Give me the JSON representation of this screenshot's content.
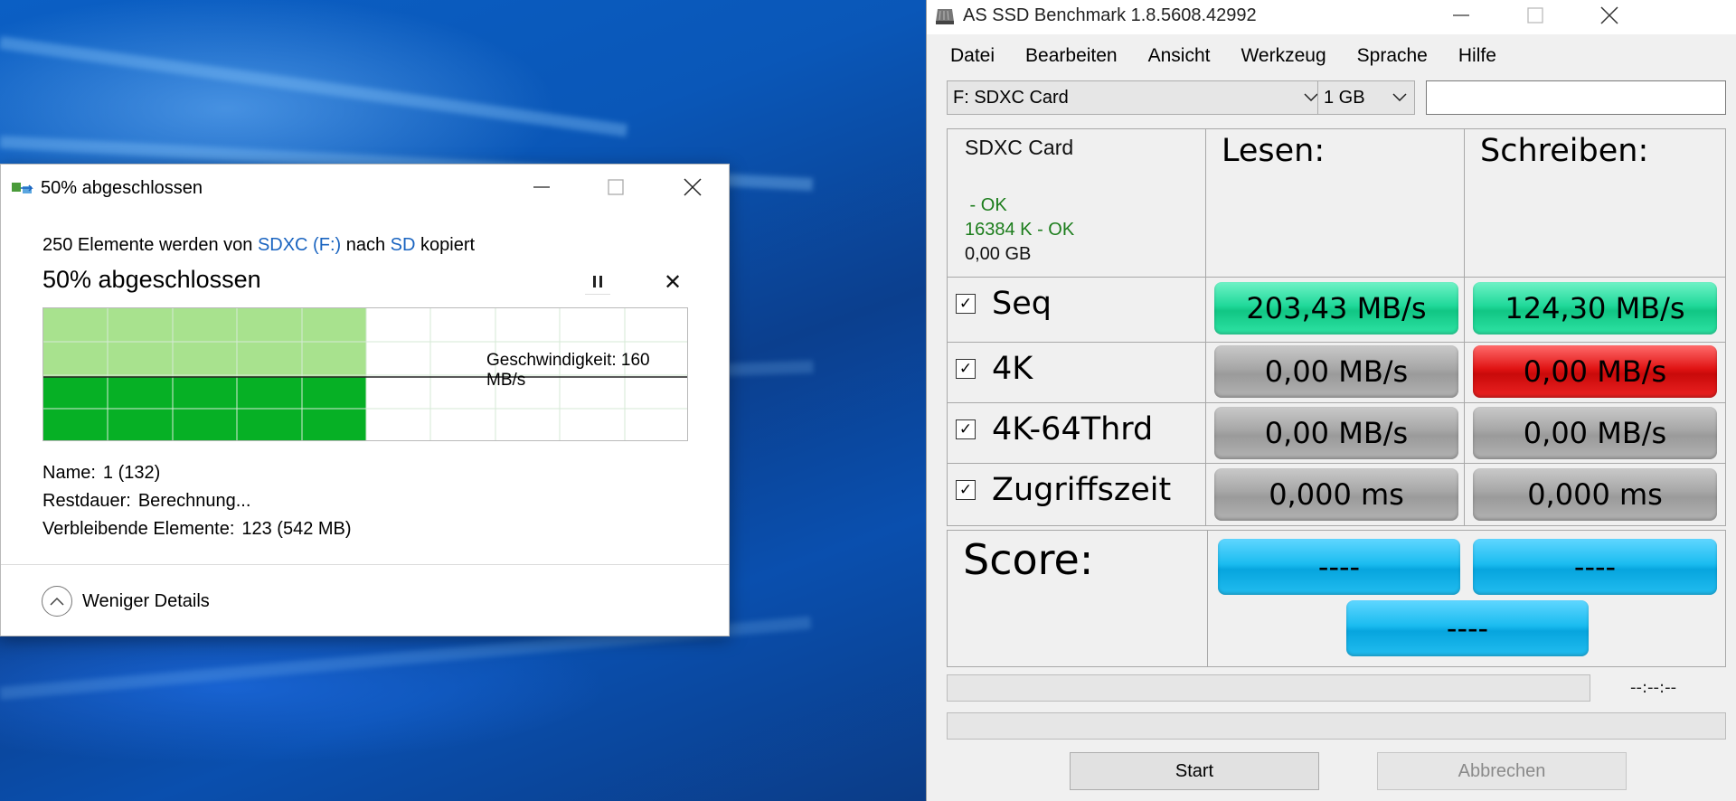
{
  "copy_dialog": {
    "title": "50% abgeschlossen",
    "from_prefix": "250 Elemente werden von",
    "source": "SDXC (F:)",
    "middle": "nach",
    "destination": "SD",
    "suffix": "kopiert",
    "heading": "50% abgeschlossen",
    "progress_fraction": 0.5,
    "speed_label": "Geschwindigkeit: 160 MB/s",
    "name_label": "Name:",
    "name_value": "1 (132)",
    "remaining_time_label": "Restdauer:",
    "remaining_time_value": "Berechnung...",
    "remaining_items_label": "Verbleibende Elemente:",
    "remaining_items_value": "123 (542 MB)",
    "less_details": "Weniger Details",
    "colors": {
      "fill_light": "#a8e28e",
      "fill_dark": "#06b025",
      "link": "#1a64c0"
    }
  },
  "as_ssd": {
    "title": "AS SSD Benchmark 1.8.5608.42992",
    "menu": [
      "Datei",
      "Bearbeiten",
      "Ansicht",
      "Werkzeug",
      "Sprache",
      "Hilfe"
    ],
    "drive_select": "F: SDXC Card",
    "size_select": "1 GB",
    "drive_info": {
      "name": "SDXC Card",
      "line1": " - OK",
      "line2": "16384 K - OK",
      "line3": "0,00 GB"
    },
    "col_read": "Lesen:",
    "col_write": "Schreiben:",
    "rows": [
      {
        "label": "Seq",
        "checked": "☑",
        "read": "203,43 MB/s",
        "write": "124,30 MB/s"
      },
      {
        "label": "4K",
        "checked": "☑",
        "read": "0,00 MB/s",
        "write": "0,00 MB/s"
      },
      {
        "label": "4K-64Thrd",
        "checked": "☑",
        "read": "0,00 MB/s",
        "write": "0,00 MB/s"
      },
      {
        "label": "Zugriffszeit",
        "checked": "☑",
        "read": "0,000 ms",
        "write": "0,000 ms"
      }
    ],
    "score_label": "Score:",
    "score_read": "----",
    "score_write": "----",
    "score_total": "----",
    "elapsed": "--:--:--",
    "start": "Start",
    "cancel": "Abbrechen",
    "colors": {
      "green": "#20d99a",
      "red": "#e01313",
      "grey": "#a6a6a6",
      "blue": "#1bbcf0"
    }
  }
}
